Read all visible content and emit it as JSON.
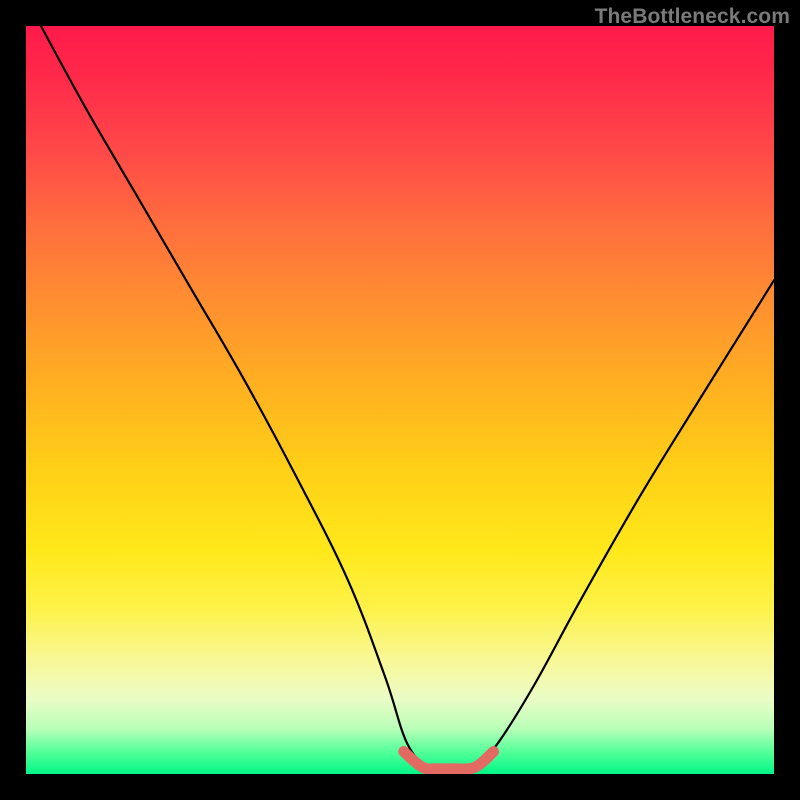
{
  "watermark": "TheBottleneck.com",
  "chart_data": {
    "type": "line",
    "title": "",
    "xlabel": "",
    "ylabel": "",
    "x_range": [
      0,
      100
    ],
    "y_range": [
      0,
      100
    ],
    "description": "V-shaped curve indicating bottleneck deviation vs component balance. Lower is better (green zone). Short salmon segment highlights the near-zero-deviation optimal region.",
    "series": [
      {
        "name": "bottleneck-curve",
        "color": "#000000",
        "x": [
          2,
          8,
          15,
          22,
          29,
          36,
          43,
          48,
          51,
          54,
          57,
          60,
          63,
          68,
          74,
          82,
          90,
          100
        ],
        "y": [
          100,
          89,
          77,
          65,
          53,
          40,
          26,
          13,
          4,
          1,
          1,
          1,
          4,
          12,
          23,
          37,
          50,
          66
        ]
      },
      {
        "name": "optimal-zone-highlight",
        "color": "#e26a63",
        "x": [
          50.5,
          53,
          55,
          57,
          60,
          62.5
        ],
        "y": [
          3.0,
          0.9,
          0.7,
          0.7,
          0.9,
          3.0
        ]
      }
    ],
    "background_gradient_stops": [
      {
        "pct": 0,
        "color": "#ff1a4b"
      },
      {
        "pct": 50,
        "color": "#ffb021"
      },
      {
        "pct": 80,
        "color": "#fdf24a"
      },
      {
        "pct": 100,
        "color": "#00f586"
      }
    ]
  }
}
